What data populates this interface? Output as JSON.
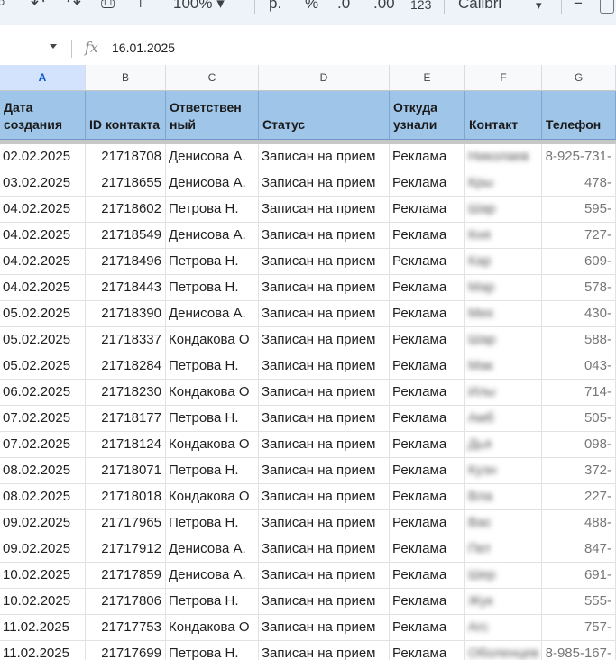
{
  "toolbar": {
    "undo_icon": "undo-icon",
    "redo_icon": "redo-icon",
    "print_icon": "print-icon",
    "paint_format_icon": "paint-format-icon",
    "zoom": "100%",
    "currency": "р.",
    "percent": "%",
    "decrease_decimal": ".0",
    "increase_decimal": ".00",
    "number_format": "123",
    "font": "Calibri",
    "font_size_minus": "−"
  },
  "formula_bar": {
    "fx_label": "fx",
    "value": "16.01.2025"
  },
  "columns": [
    "A",
    "B",
    "C",
    "D",
    "E",
    "F",
    "G"
  ],
  "headers": {
    "a": "Дата создания",
    "b": "ID контакта",
    "c": "Ответствен ный",
    "d": "Статус",
    "e": "Откуда узнали",
    "f": "Контакт",
    "g": "Телефон"
  },
  "rows": [
    {
      "date": "02.02.2025",
      "id": "21718708",
      "resp": "Денисова А.",
      "status": "Записан на прием",
      "source": "Реклама",
      "contact": "Николаев",
      "phone": "8-925-731-"
    },
    {
      "date": "03.02.2025",
      "id": "21718655",
      "resp": "Денисова А.",
      "status": "Записан на прием",
      "source": "Реклама",
      "contact": "Кры",
      "phone": "478-"
    },
    {
      "date": "04.02.2025",
      "id": "21718602",
      "resp": "Петрова Н.",
      "status": "Записан на прием",
      "source": "Реклама",
      "contact": "Шар",
      "phone": "595-"
    },
    {
      "date": "04.02.2025",
      "id": "21718549",
      "resp": "Денисова А.",
      "status": "Записан на прием",
      "source": "Реклама",
      "contact": "Кня",
      "phone": "727-"
    },
    {
      "date": "04.02.2025",
      "id": "21718496",
      "resp": "Петрова Н.",
      "status": "Записан на прием",
      "source": "Реклама",
      "contact": "Кар",
      "phone": "609-"
    },
    {
      "date": "04.02.2025",
      "id": "21718443",
      "resp": "Петрова Н.",
      "status": "Записан на прием",
      "source": "Реклама",
      "contact": "Мар",
      "phone": "578-"
    },
    {
      "date": "05.02.2025",
      "id": "21718390",
      "resp": "Денисова А.",
      "status": "Записан на прием",
      "source": "Реклама",
      "contact": "Мих",
      "phone": "430-"
    },
    {
      "date": "05.02.2025",
      "id": "21718337",
      "resp": "Кондакова О",
      "status": "Записан на прием",
      "source": "Реклама",
      "contact": "Шар",
      "phone": "588-"
    },
    {
      "date": "05.02.2025",
      "id": "21718284",
      "resp": "Петрова Н.",
      "status": "Записан на прием",
      "source": "Реклама",
      "contact": "Мак",
      "phone": "043-"
    },
    {
      "date": "06.02.2025",
      "id": "21718230",
      "resp": "Кондакова О",
      "status": "Записан на прием",
      "source": "Реклама",
      "contact": "Илы",
      "phone": "714-"
    },
    {
      "date": "07.02.2025",
      "id": "21718177",
      "resp": "Петрова Н.",
      "status": "Записан на прием",
      "source": "Реклама",
      "contact": "Амб",
      "phone": "505-"
    },
    {
      "date": "07.02.2025",
      "id": "21718124",
      "resp": "Кондакова О",
      "status": "Записан на прием",
      "source": "Реклама",
      "contact": "Дья",
      "phone": "098-"
    },
    {
      "date": "08.02.2025",
      "id": "21718071",
      "resp": "Петрова Н.",
      "status": "Записан на прием",
      "source": "Реклама",
      "contact": "Кузн",
      "phone": "372-"
    },
    {
      "date": "08.02.2025",
      "id": "21718018",
      "resp": "Кондакова О",
      "status": "Записан на прием",
      "source": "Реклама",
      "contact": "Вла",
      "phone": "227-"
    },
    {
      "date": "09.02.2025",
      "id": "21717965",
      "resp": "Петрова Н.",
      "status": "Записан на прием",
      "source": "Реклама",
      "contact": "Вас",
      "phone": "488-"
    },
    {
      "date": "09.02.2025",
      "id": "21717912",
      "resp": "Денисова А.",
      "status": "Записан на прием",
      "source": "Реклама",
      "contact": "Пет",
      "phone": "847-"
    },
    {
      "date": "10.02.2025",
      "id": "21717859",
      "resp": "Денисова А.",
      "status": "Записан на прием",
      "source": "Реклама",
      "contact": "Шер",
      "phone": "691-"
    },
    {
      "date": "10.02.2025",
      "id": "21717806",
      "resp": "Петрова Н.",
      "status": "Записан на прием",
      "source": "Реклама",
      "contact": "Жук",
      "phone": "555-"
    },
    {
      "date": "11.02.2025",
      "id": "21717753",
      "resp": "Кондакова О",
      "status": "Записан на прием",
      "source": "Реклама",
      "contact": "Агс",
      "phone": "757-"
    },
    {
      "date": "11.02.2025",
      "id": "21717699",
      "resp": "Петрова Н.",
      "status": "Записан на прием",
      "source": "Реклама",
      "contact": "Оболенцев",
      "phone": "8-985-167-"
    }
  ],
  "colors": {
    "header_fill": "#9fc5e8",
    "selected_column": "#d3e3fd",
    "toolbar_bg": "#eef2f9"
  }
}
